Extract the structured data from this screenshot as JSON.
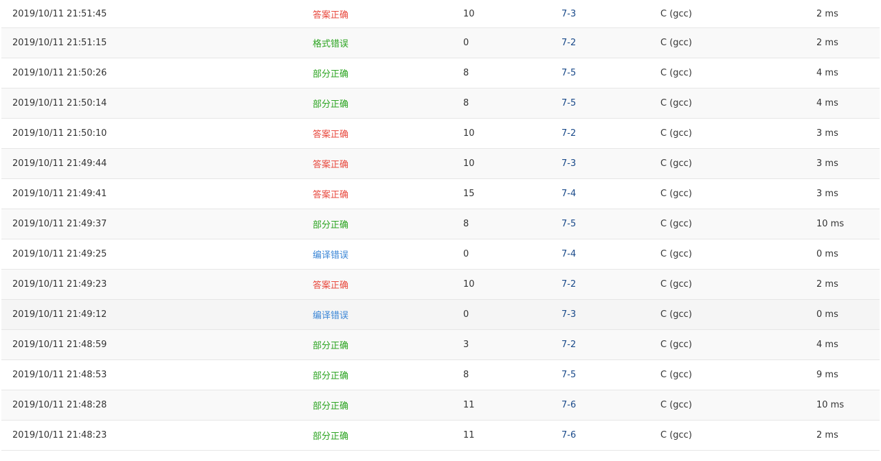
{
  "colors": {
    "accepted": "#e8473c",
    "partial": "#2aa31f",
    "format_error": "#2aa31f",
    "compile_error": "#3b86d6",
    "link": "#1a4a8a"
  },
  "rows": [
    {
      "time": "2019/10/11 21:51:45",
      "status": "答案正确",
      "status_type": "accepted",
      "score": "10",
      "problem": "7-3",
      "lang": "C (gcc)",
      "cost": "2 ms"
    },
    {
      "time": "2019/10/11 21:51:15",
      "status": "格式错误",
      "status_type": "format_error",
      "score": "0",
      "problem": "7-2",
      "lang": "C (gcc)",
      "cost": "2 ms"
    },
    {
      "time": "2019/10/11 21:50:26",
      "status": "部分正确",
      "status_type": "partial",
      "score": "8",
      "problem": "7-5",
      "lang": "C (gcc)",
      "cost": "4 ms"
    },
    {
      "time": "2019/10/11 21:50:14",
      "status": "部分正确",
      "status_type": "partial",
      "score": "8",
      "problem": "7-5",
      "lang": "C (gcc)",
      "cost": "4 ms"
    },
    {
      "time": "2019/10/11 21:50:10",
      "status": "答案正确",
      "status_type": "accepted",
      "score": "10",
      "problem": "7-2",
      "lang": "C (gcc)",
      "cost": "3 ms"
    },
    {
      "time": "2019/10/11 21:49:44",
      "status": "答案正确",
      "status_type": "accepted",
      "score": "10",
      "problem": "7-3",
      "lang": "C (gcc)",
      "cost": "3 ms"
    },
    {
      "time": "2019/10/11 21:49:41",
      "status": "答案正确",
      "status_type": "accepted",
      "score": "15",
      "problem": "7-4",
      "lang": "C (gcc)",
      "cost": "3 ms"
    },
    {
      "time": "2019/10/11 21:49:37",
      "status": "部分正确",
      "status_type": "partial",
      "score": "8",
      "problem": "7-5",
      "lang": "C (gcc)",
      "cost": "10 ms"
    },
    {
      "time": "2019/10/11 21:49:25",
      "status": "编译错误",
      "status_type": "compile_error",
      "score": "0",
      "problem": "7-4",
      "lang": "C (gcc)",
      "cost": "0 ms"
    },
    {
      "time": "2019/10/11 21:49:23",
      "status": "答案正确",
      "status_type": "accepted",
      "score": "10",
      "problem": "7-2",
      "lang": "C (gcc)",
      "cost": "2 ms"
    },
    {
      "time": "2019/10/11 21:49:12",
      "status": "编译错误",
      "status_type": "compile_error",
      "score": "0",
      "problem": "7-3",
      "lang": "C (gcc)",
      "cost": "0 ms",
      "hovered": true
    },
    {
      "time": "2019/10/11 21:48:59",
      "status": "部分正确",
      "status_type": "partial",
      "score": "3",
      "problem": "7-2",
      "lang": "C (gcc)",
      "cost": "4 ms"
    },
    {
      "time": "2019/10/11 21:48:53",
      "status": "部分正确",
      "status_type": "partial",
      "score": "8",
      "problem": "7-5",
      "lang": "C (gcc)",
      "cost": "9 ms"
    },
    {
      "time": "2019/10/11 21:48:28",
      "status": "部分正确",
      "status_type": "partial",
      "score": "11",
      "problem": "7-6",
      "lang": "C (gcc)",
      "cost": "10 ms"
    },
    {
      "time": "2019/10/11 21:48:23",
      "status": "部分正确",
      "status_type": "partial",
      "score": "11",
      "problem": "7-6",
      "lang": "C (gcc)",
      "cost": "2 ms"
    }
  ]
}
